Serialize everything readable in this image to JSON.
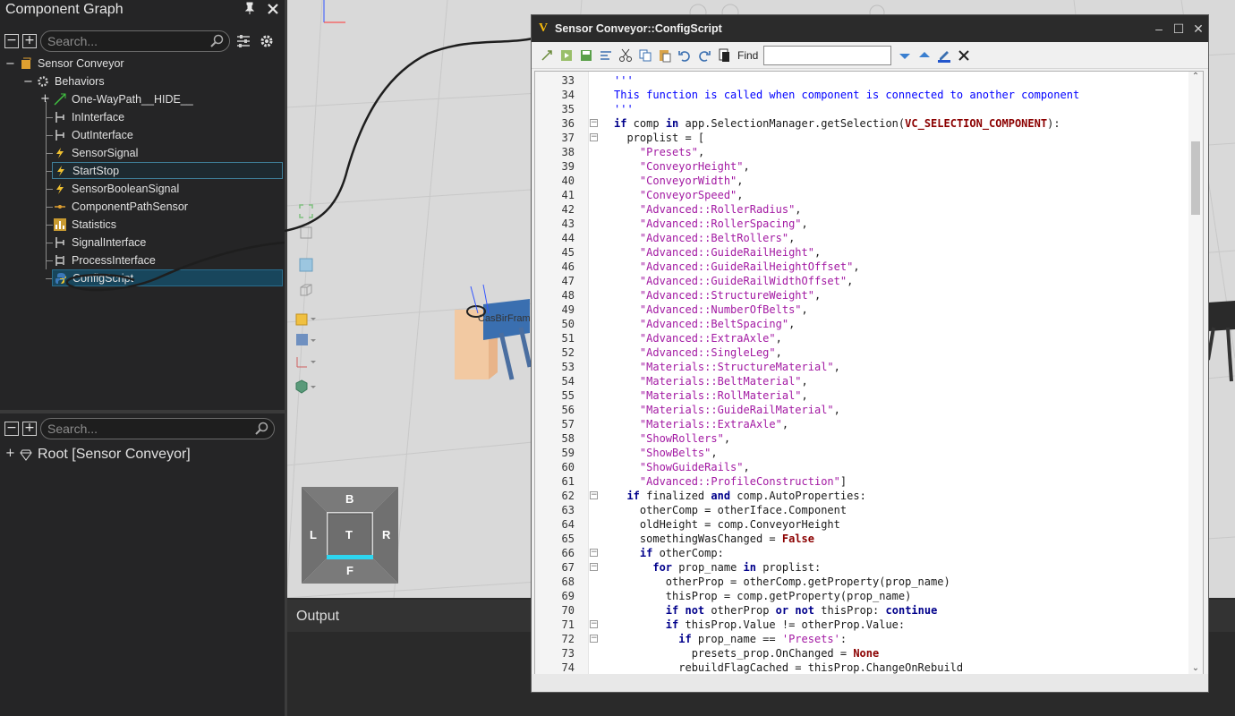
{
  "left_panel": {
    "title": "Component Graph",
    "search_placeholder": "Search...",
    "tree": {
      "root": "Sensor Conveyor",
      "behaviors": "Behaviors",
      "items": [
        "One-WayPath__HIDE__",
        "InInterface",
        "OutInterface",
        "SensorSignal",
        "StartStop",
        "SensorBooleanSignal",
        "ComponentPathSensor",
        "Statistics",
        "SignalInterface",
        "ProcessInterface",
        "ConfigScript"
      ]
    },
    "lower_search_placeholder": "Search...",
    "lower_root": "Root [Sensor Conveyor]"
  },
  "viewport": {
    "cube": {
      "top": "B",
      "left": "L",
      "center": "T",
      "right": "R",
      "bottom": "F"
    },
    "label_fragment": "CasBirFrame"
  },
  "output": {
    "title": "Output"
  },
  "script_window": {
    "title": "Sensor Conveyor::ConfigScript",
    "find_label": "Find",
    "find_value": "",
    "first_line_number": 33,
    "lines": [
      "'''",
      "This function is called when component is connected to another component",
      "'''",
      "if comp in app.SelectionManager.getSelection(VC_SELECTION_COMPONENT):",
      "  proplist = [",
      "    \"Presets\",",
      "    \"ConveyorHeight\",",
      "    \"ConveyorWidth\",",
      "    \"ConveyorSpeed\",",
      "    \"Advanced::RollerRadius\",",
      "    \"Advanced::RollerSpacing\",",
      "    \"Advanced::BeltRollers\",",
      "    \"Advanced::GuideRailHeight\",",
      "    \"Advanced::GuideRailHeightOffset\",",
      "    \"Advanced::GuideRailWidthOffset\",",
      "    \"Advanced::StructureWeight\",",
      "    \"Advanced::NumberOfBelts\",",
      "    \"Advanced::BeltSpacing\",",
      "    \"Advanced::ExtraAxle\",",
      "    \"Advanced::SingleLeg\",",
      "    \"Materials::StructureMaterial\",",
      "    \"Materials::BeltMaterial\",",
      "    \"Materials::RollMaterial\",",
      "    \"Materials::GuideRailMaterial\",",
      "    \"Materials::ExtraAxle\",",
      "    \"ShowRollers\",",
      "    \"ShowBelts\",",
      "    \"ShowGuideRails\",",
      "    \"Advanced::ProfileConstruction\"]",
      "  if finalized and comp.AutoProperties:",
      "    otherComp = otherIface.Component",
      "    oldHeight = comp.ConveyorHeight",
      "    somethingWasChanged = False",
      "    if otherComp:",
      "      for prop_name in proplist:",
      "        otherProp = otherComp.getProperty(prop_name)",
      "        thisProp = comp.getProperty(prop_name)",
      "        if not otherProp or not thisProp: continue",
      "        if thisProp.Value != otherProp.Value:",
      "          if prop_name == 'Presets':",
      "            presets_prop.OnChanged = None",
      "          rebuildFlagCached = thisProp.ChangeOnRebuild"
    ]
  }
}
